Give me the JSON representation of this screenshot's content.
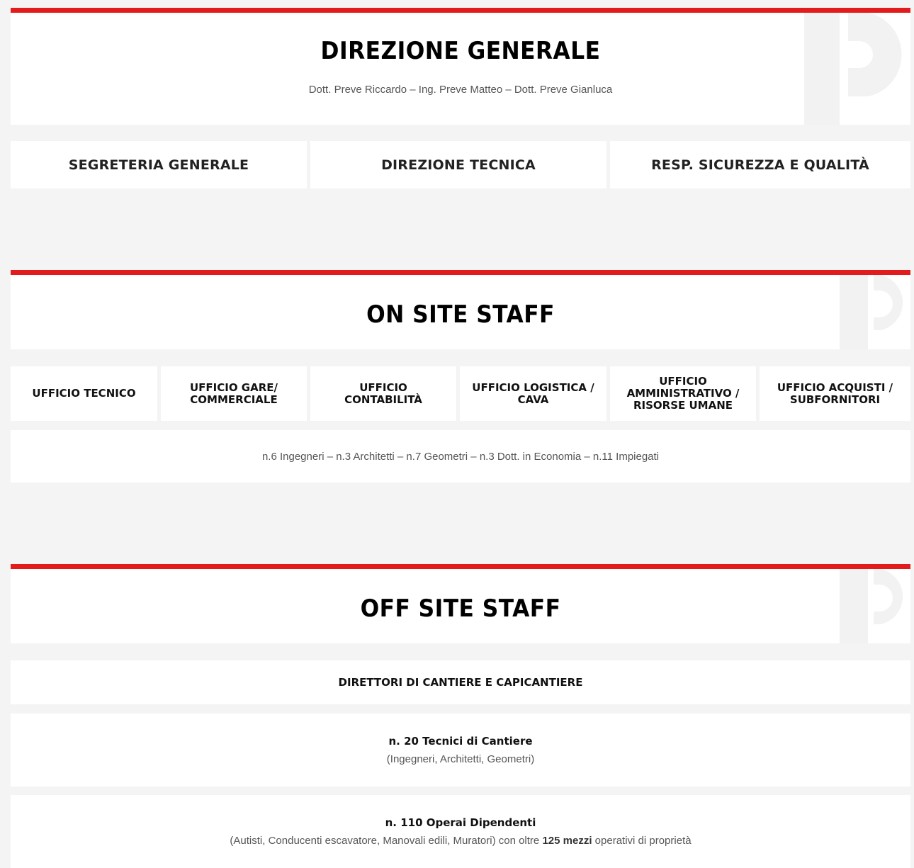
{
  "direzione": {
    "title": "DIREZIONE GENERALE",
    "names": "Dott. Preve Riccardo – Ing. Preve Matteo – Dott. Preve Gianluca",
    "boxes": [
      "SEGRETERIA GENERALE",
      "DIREZIONE TECNICA",
      "RESP. SICUREZZA E QUALITÀ"
    ]
  },
  "on_site": {
    "title": "ON SITE STAFF",
    "offices": [
      "UFFICIO TECNICO",
      "UFFICIO GARE/ COMMERCIALE",
      "UFFICIO CONTABILITÀ",
      "UFFICIO LOGISTICA / CAVA",
      "UFFICIO AMMINISTRATIVO / RISORSE UMANE",
      "UFFICIO ACQUISTI / SUBFORNITORI"
    ],
    "staff_line": "n.6 Ingegneri – n.3 Architetti – n.7 Geometri – n.3 Dott. in Economia – n.11 Impiegati"
  },
  "off_site": {
    "title": "OFF SITE STAFF",
    "directors": "DIRETTORI DI CANTIERE E CAPICANTIERE",
    "tecnici_title": "n. 20 Tecnici di Cantiere",
    "tecnici_detail": "(Ingegneri, Architetti, Geometri)",
    "operai_title": "n. 110 Operai Dipendenti",
    "operai_detail_pre": "(Autisti, Conducenti escavatore, Manovali edili, Muratori) con oltre",
    "operai_detail_bold": "125 mezzi",
    "operai_detail_post": "operativi di proprietà"
  },
  "colors": {
    "accent": "#e21c1c",
    "panel": "#ffffff",
    "background": "#f4f4f4",
    "watermark": "#f2f2f2"
  },
  "icons": {
    "watermark": "brand-p-logo-icon"
  }
}
